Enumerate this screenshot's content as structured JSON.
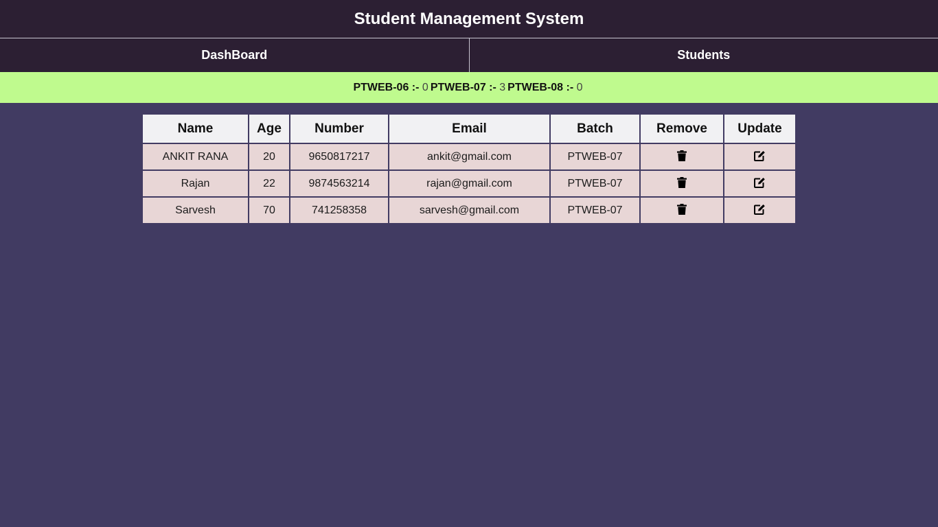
{
  "app": {
    "title": "Student Management System"
  },
  "nav": {
    "dashboard_label": "DashBoard",
    "students_label": "Students"
  },
  "batch_summary": [
    {
      "label": "PTWEB-06 :-",
      "count": "0"
    },
    {
      "label": "PTWEB-07 :-",
      "count": "3"
    },
    {
      "label": "PTWEB-08 :-",
      "count": "0"
    }
  ],
  "table": {
    "headers": [
      "Name",
      "Age",
      "Number",
      "Email",
      "Batch",
      "Remove",
      "Update"
    ],
    "rows": [
      {
        "name": "ANKIT RANA",
        "age": "20",
        "number": "9650817217",
        "email": "ankit@gmail.com",
        "batch": "PTWEB-07",
        "remove_icon": "trash-icon",
        "update_icon": "edit-icon"
      },
      {
        "name": "Rajan",
        "age": "22",
        "number": "9874563214",
        "email": "rajan@gmail.com",
        "batch": "PTWEB-07",
        "remove_icon": "trash-icon",
        "update_icon": "edit-icon"
      },
      {
        "name": "Sarvesh",
        "age": "70",
        "number": "741258358",
        "email": "sarvesh@gmail.com",
        "batch": "PTWEB-07",
        "remove_icon": "trash-icon",
        "update_icon": "edit-icon"
      }
    ]
  },
  "colors": {
    "header_bg": "#2c1f33",
    "page_bg": "#413b62",
    "batch_bar_bg": "#bffa8e",
    "table_header_bg": "#f1f1f3",
    "table_row_bg": "#e8d6d6"
  }
}
